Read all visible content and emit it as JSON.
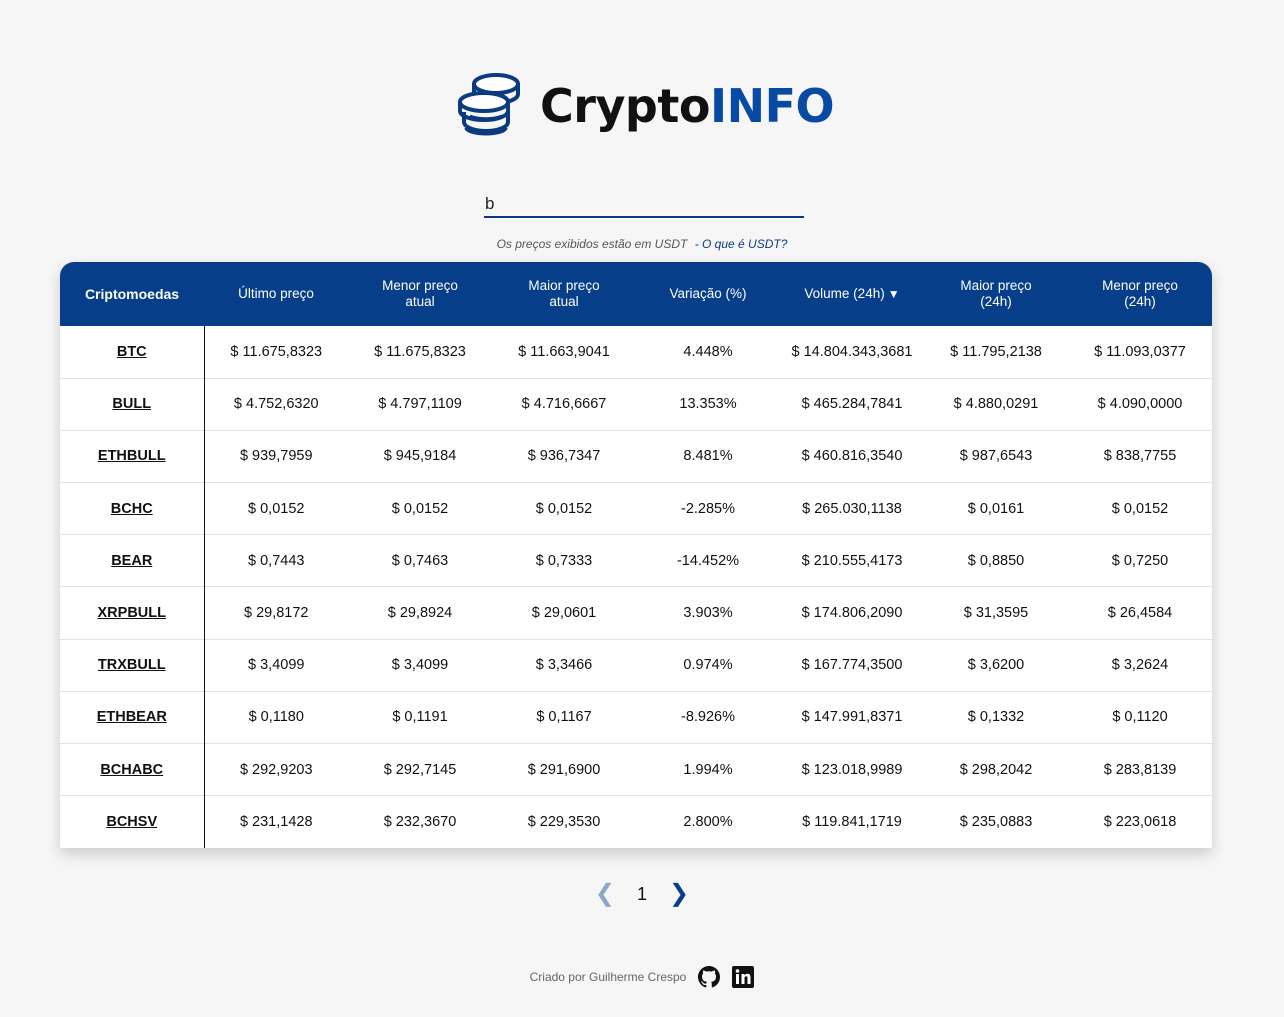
{
  "logo": {
    "text_a": "Crypto",
    "text_b": "INFO",
    "icon": "coins-icon"
  },
  "search": {
    "value": "b",
    "placeholder": ""
  },
  "note": {
    "text": "Os preços exibidos estão em USDT",
    "link": "- O que é USDT?"
  },
  "table": {
    "headers": [
      {
        "label": "Criptomoedas"
      },
      {
        "label": "Último preço"
      },
      {
        "label1": "Menor preço",
        "label2": "atual"
      },
      {
        "label1": "Maior preço",
        "label2": "atual"
      },
      {
        "label": "Variação (%)"
      },
      {
        "label": "Volume (24h)",
        "sort_icon": "caret-down-icon",
        "sort_glyph": "▼"
      },
      {
        "label1": "Maior preço",
        "label2": "(24h)"
      },
      {
        "label1": "Menor preço",
        "label2": "(24h)"
      }
    ],
    "rows": [
      [
        "BTC",
        "$ 11.675,8323",
        "$ 11.675,8323",
        "$ 11.663,9041",
        "4.448%",
        "$ 14.804.343,3681",
        "$ 11.795,2138",
        "$ 11.093,0377"
      ],
      [
        "BULL",
        "$ 4.752,6320",
        "$ 4.797,1109",
        "$ 4.716,6667",
        "13.353%",
        "$ 465.284,7841",
        "$ 4.880,0291",
        "$ 4.090,0000"
      ],
      [
        "ETHBULL",
        "$ 939,7959",
        "$ 945,9184",
        "$ 936,7347",
        "8.481%",
        "$ 460.816,3540",
        "$ 987,6543",
        "$ 838,7755"
      ],
      [
        "BCHC",
        "$ 0,0152",
        "$ 0,0152",
        "$ 0,0152",
        "-2.285%",
        "$ 265.030,1138",
        "$ 0,0161",
        "$ 0,0152"
      ],
      [
        "BEAR",
        "$ 0,7443",
        "$ 0,7463",
        "$ 0,7333",
        "-14.452%",
        "$ 210.555,4173",
        "$ 0,8850",
        "$ 0,7250"
      ],
      [
        "XRPBULL",
        "$ 29,8172",
        "$ 29,8924",
        "$ 29,0601",
        "3.903%",
        "$ 174.806,2090",
        "$ 31,3595",
        "$ 26,4584"
      ],
      [
        "TRXBULL",
        "$ 3,4099",
        "$ 3,4099",
        "$ 3,3466",
        "0.974%",
        "$ 167.774,3500",
        "$ 3,6200",
        "$ 3,2624"
      ],
      [
        "ETHBEAR",
        "$ 0,1180",
        "$ 0,1191",
        "$ 0,1167",
        "-8.926%",
        "$ 147.991,8371",
        "$ 0,1332",
        "$ 0,1120"
      ],
      [
        "BCHABC",
        "$ 292,9203",
        "$ 292,7145",
        "$ 291,6900",
        "1.994%",
        "$ 123.018,9989",
        "$ 298,2042",
        "$ 283,8139"
      ],
      [
        "BCHSV",
        "$ 231,1428",
        "$ 232,3670",
        "$ 229,3530",
        "2.800%",
        "$ 119.841,1719",
        "$ 235,0883",
        "$ 223,0618"
      ]
    ]
  },
  "pagination": {
    "prev_glyph": "❮",
    "current": "1",
    "next_glyph": "❯"
  },
  "footer": {
    "text": "Criado por Guilherme Crespo",
    "icons": [
      "github-icon",
      "linkedin-icon"
    ]
  },
  "colors": {
    "primary": "#063e8a",
    "logo_accent": "#064aa5",
    "background": "#f6f6f6"
  }
}
